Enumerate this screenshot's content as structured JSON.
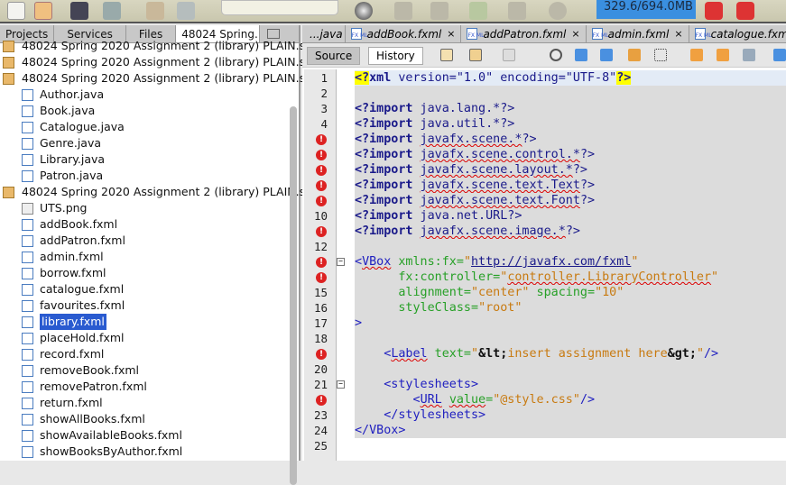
{
  "toolbar": {
    "memory": "329.6/694.0MB",
    "combo_value": "",
    "icons": [
      "new-file-icon",
      "new-project-icon",
      "open-project-icon",
      "save-all-icon",
      "undo-icon",
      "redo-icon",
      "globe-icon",
      "build-icon",
      "clean-build-icon",
      "run-icon",
      "debug-icon",
      "profile-icon",
      "gc-icon",
      "pause-icon"
    ]
  },
  "left": {
    "tabs": [
      "Projects",
      "Services",
      "Files",
      "48024 Spring..."
    ],
    "tab_close": "×",
    "items": [
      {
        "label": "48024 Spring 2020 Assignment 2 (library) PLAIN.s",
        "type": "pkg",
        "indent": 0
      },
      {
        "label": "48024 Spring 2020 Assignment 2 (library) PLAIN.s",
        "type": "pkg",
        "indent": 0
      },
      {
        "label": "48024 Spring 2020 Assignment 2 (library) PLAIN.s",
        "type": "pkg",
        "indent": 0
      },
      {
        "label": "Author.java",
        "type": "file",
        "indent": 1
      },
      {
        "label": "Book.java",
        "type": "file",
        "indent": 1
      },
      {
        "label": "Catalogue.java",
        "type": "file",
        "indent": 1
      },
      {
        "label": "Genre.java",
        "type": "file",
        "indent": 1
      },
      {
        "label": "Library.java",
        "type": "file",
        "indent": 1
      },
      {
        "label": "Patron.java",
        "type": "file",
        "indent": 1
      },
      {
        "label": "48024 Spring 2020 Assignment 2 (library) PLAIN.s",
        "type": "pkg",
        "indent": 0
      },
      {
        "label": "UTS.png",
        "type": "img",
        "indent": 1
      },
      {
        "label": "addBook.fxml",
        "type": "file",
        "indent": 1
      },
      {
        "label": "addPatron.fxml",
        "type": "file",
        "indent": 1
      },
      {
        "label": "admin.fxml",
        "type": "file",
        "indent": 1
      },
      {
        "label": "borrow.fxml",
        "type": "file",
        "indent": 1
      },
      {
        "label": "catalogue.fxml",
        "type": "file",
        "indent": 1
      },
      {
        "label": "favourites.fxml",
        "type": "file",
        "indent": 1
      },
      {
        "label": "library.fxml",
        "type": "file",
        "indent": 1,
        "selected": true
      },
      {
        "label": "placeHold.fxml",
        "type": "file",
        "indent": 1
      },
      {
        "label": "record.fxml",
        "type": "file",
        "indent": 1
      },
      {
        "label": "removeBook.fxml",
        "type": "file",
        "indent": 1
      },
      {
        "label": "removePatron.fxml",
        "type": "file",
        "indent": 1
      },
      {
        "label": "return.fxml",
        "type": "file",
        "indent": 1
      },
      {
        "label": "showAllBooks.fxml",
        "type": "file",
        "indent": 1
      },
      {
        "label": "showAvailableBooks.fxml",
        "type": "file",
        "indent": 1
      },
      {
        "label": "showBooksByAuthor.fxml",
        "type": "file",
        "indent": 1
      }
    ]
  },
  "editor": {
    "tabs": [
      "...java",
      "addBook.fxml",
      "addPatron.fxml",
      "admin.fxml",
      "catalogue.fxml"
    ],
    "tab_close": "×",
    "file_icon": "FX ML",
    "source": "Source",
    "history": "History",
    "lines": [
      {
        "n": "1",
        "cur": true,
        "t": [
          [
            "<?",
            "hl"
          ],
          [
            "xml",
            "pi"
          ],
          [
            " version=\"1.0\" encoding=\"UTF-8\"",
            "pn"
          ],
          [
            "?>",
            "hl"
          ]
        ]
      },
      {
        "n": "2",
        "t": []
      },
      {
        "n": "3",
        "t": [
          [
            "<?import",
            "pi"
          ],
          [
            " java.lang.*?>",
            "pn"
          ]
        ]
      },
      {
        "n": "4",
        "t": [
          [
            "<?import",
            "pi"
          ],
          [
            " java.util.*?>",
            "pn"
          ]
        ]
      },
      {
        "n": "5",
        "err": true,
        "t": [
          [
            "<?import",
            "pi"
          ],
          [
            " ",
            "pn"
          ],
          [
            "javafx.scene.*",
            "pn u"
          ],
          [
            "?>",
            "pn"
          ]
        ]
      },
      {
        "n": "6",
        "err": true,
        "t": [
          [
            "<?import",
            "pi"
          ],
          [
            " ",
            "pn"
          ],
          [
            "javafx.scene.control.*",
            "pn u"
          ],
          [
            "?>",
            "pn"
          ]
        ]
      },
      {
        "n": "7",
        "err": true,
        "t": [
          [
            "<?import",
            "pi"
          ],
          [
            " ",
            "pn"
          ],
          [
            "javafx.scene.layout.*",
            "pn u"
          ],
          [
            "?>",
            "pn"
          ]
        ]
      },
      {
        "n": "8",
        "err": true,
        "t": [
          [
            "<?import",
            "pi"
          ],
          [
            " ",
            "pn"
          ],
          [
            "javafx.scene.text.Text",
            "pn u"
          ],
          [
            "?>",
            "pn"
          ]
        ]
      },
      {
        "n": "9",
        "err": true,
        "t": [
          [
            "<?import",
            "pi"
          ],
          [
            " ",
            "pn"
          ],
          [
            "javafx.scene.text.Font",
            "pn u"
          ],
          [
            "?>",
            "pn"
          ]
        ]
      },
      {
        "n": "10",
        "t": [
          [
            "<?import",
            "pi"
          ],
          [
            " java.net.URL?>",
            "pn"
          ]
        ]
      },
      {
        "n": "11",
        "err": true,
        "t": [
          [
            "<?import",
            "pi"
          ],
          [
            " ",
            "pn"
          ],
          [
            "javafx.scene.image.*",
            "pn u"
          ],
          [
            "?>",
            "pn"
          ]
        ]
      },
      {
        "n": "12",
        "t": []
      },
      {
        "n": "13",
        "err": true,
        "fold": true,
        "t": [
          [
            "<",
            "tag"
          ],
          [
            "VBox",
            "tag u"
          ],
          [
            " xmlns:fx=",
            "at"
          ],
          [
            "\"",
            "val"
          ],
          [
            "http://javafx.com/fxml",
            "url"
          ],
          [
            "\"",
            "val"
          ]
        ]
      },
      {
        "n": "14",
        "err": true,
        "t": [
          [
            "      fx:controller=",
            "at"
          ],
          [
            "\"",
            "val"
          ],
          [
            "controller.LibraryController",
            "val u"
          ],
          [
            "\"",
            "val"
          ]
        ]
      },
      {
        "n": "15",
        "t": [
          [
            "      alignment=",
            "at"
          ],
          [
            "\"center\"",
            "val"
          ],
          [
            " spacing=",
            "at"
          ],
          [
            "\"10\"",
            "val"
          ]
        ]
      },
      {
        "n": "16",
        "t": [
          [
            "      styleClass=",
            "at"
          ],
          [
            "\"root\"",
            "val"
          ]
        ]
      },
      {
        "n": "17",
        "t": [
          [
            ">",
            "tag"
          ]
        ]
      },
      {
        "n": "18",
        "t": []
      },
      {
        "n": "19",
        "err": true,
        "t": [
          [
            "    <",
            "tag"
          ],
          [
            "Label",
            "tag u"
          ],
          [
            " text=",
            "at"
          ],
          [
            "\"",
            "val"
          ],
          [
            "&lt;",
            "ent"
          ],
          [
            "insert assignment here",
            "val"
          ],
          [
            "&gt;",
            "ent"
          ],
          [
            "\"",
            "val"
          ],
          [
            "/>",
            "tag"
          ]
        ]
      },
      {
        "n": "20",
        "t": []
      },
      {
        "n": "21",
        "fold": true,
        "t": [
          [
            "    <stylesheets>",
            "tag"
          ]
        ]
      },
      {
        "n": "22",
        "err": true,
        "t": [
          [
            "        <",
            "tag"
          ],
          [
            "URL",
            "tag u"
          ],
          [
            " ",
            "at"
          ],
          [
            "value",
            "at u"
          ],
          [
            "=",
            "at"
          ],
          [
            "\"@style.css\"",
            "val"
          ],
          [
            "/>",
            "tag"
          ]
        ]
      },
      {
        "n": "23",
        "t": [
          [
            "    </stylesheets>",
            "tag"
          ]
        ]
      },
      {
        "n": "24",
        "t": [
          [
            "</VBox>",
            "tag"
          ]
        ]
      },
      {
        "n": "25",
        "noshade": true,
        "t": []
      }
    ]
  }
}
